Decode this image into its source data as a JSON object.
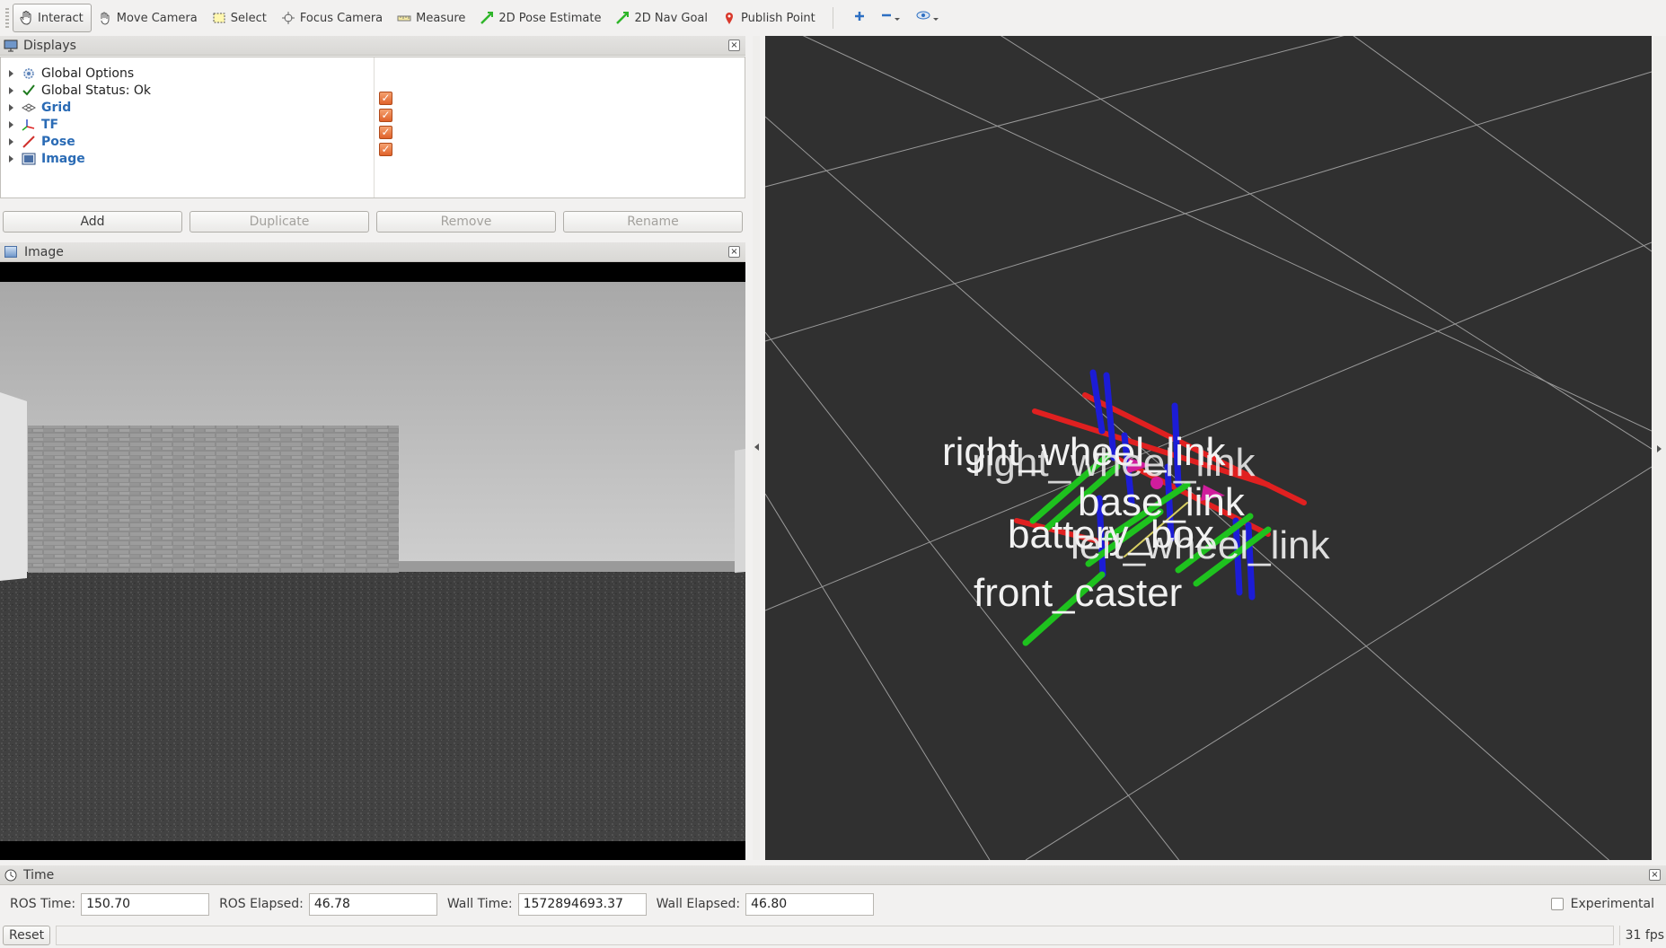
{
  "toolbar": {
    "tools": [
      {
        "label": "Interact",
        "icon": "hand-icon"
      },
      {
        "label": "Move Camera",
        "icon": "move-camera-icon"
      },
      {
        "label": "Select",
        "icon": "select-icon"
      },
      {
        "label": "Focus Camera",
        "icon": "focus-camera-icon"
      },
      {
        "label": "Measure",
        "icon": "measure-icon"
      },
      {
        "label": "2D Pose Estimate",
        "icon": "pose-estimate-icon"
      },
      {
        "label": "2D Nav Goal",
        "icon": "nav-goal-icon"
      },
      {
        "label": "Publish Point",
        "icon": "publish-point-icon"
      }
    ]
  },
  "displays": {
    "title": "Displays",
    "items": [
      {
        "label": "Global Options",
        "style": "plain",
        "checked": null
      },
      {
        "label": "Global Status: Ok",
        "style": "plain",
        "checked": null
      },
      {
        "label": "Grid",
        "style": "blue",
        "checked": true
      },
      {
        "label": "TF",
        "style": "blue",
        "checked": true
      },
      {
        "label": "Pose",
        "style": "blue",
        "checked": true
      },
      {
        "label": "Image",
        "style": "blue",
        "checked": true
      }
    ],
    "buttons": {
      "add": "Add",
      "duplicate": "Duplicate",
      "remove": "Remove",
      "rename": "Rename"
    }
  },
  "image_panel": {
    "title": "Image"
  },
  "view3d": {
    "frame_labels": [
      "right_wheel_link",
      "right_wheel_link",
      "base_link",
      "battery_box",
      "left_wheel_link",
      "front_caster"
    ]
  },
  "time": {
    "title": "Time",
    "ros_time_label": "ROS Time:",
    "ros_time": "150.70",
    "ros_elapsed_label": "ROS Elapsed:",
    "ros_elapsed": "46.78",
    "wall_time_label": "Wall Time:",
    "wall_time": "1572894693.37",
    "wall_elapsed_label": "Wall Elapsed:",
    "wall_elapsed": "46.80",
    "experimental_label": "Experimental"
  },
  "status": {
    "reset_label": "Reset",
    "fps": "31 fps"
  },
  "colors": {
    "check": "#e0622a",
    "tree_blue": "#2a6bb5",
    "view_bg": "#303030"
  }
}
